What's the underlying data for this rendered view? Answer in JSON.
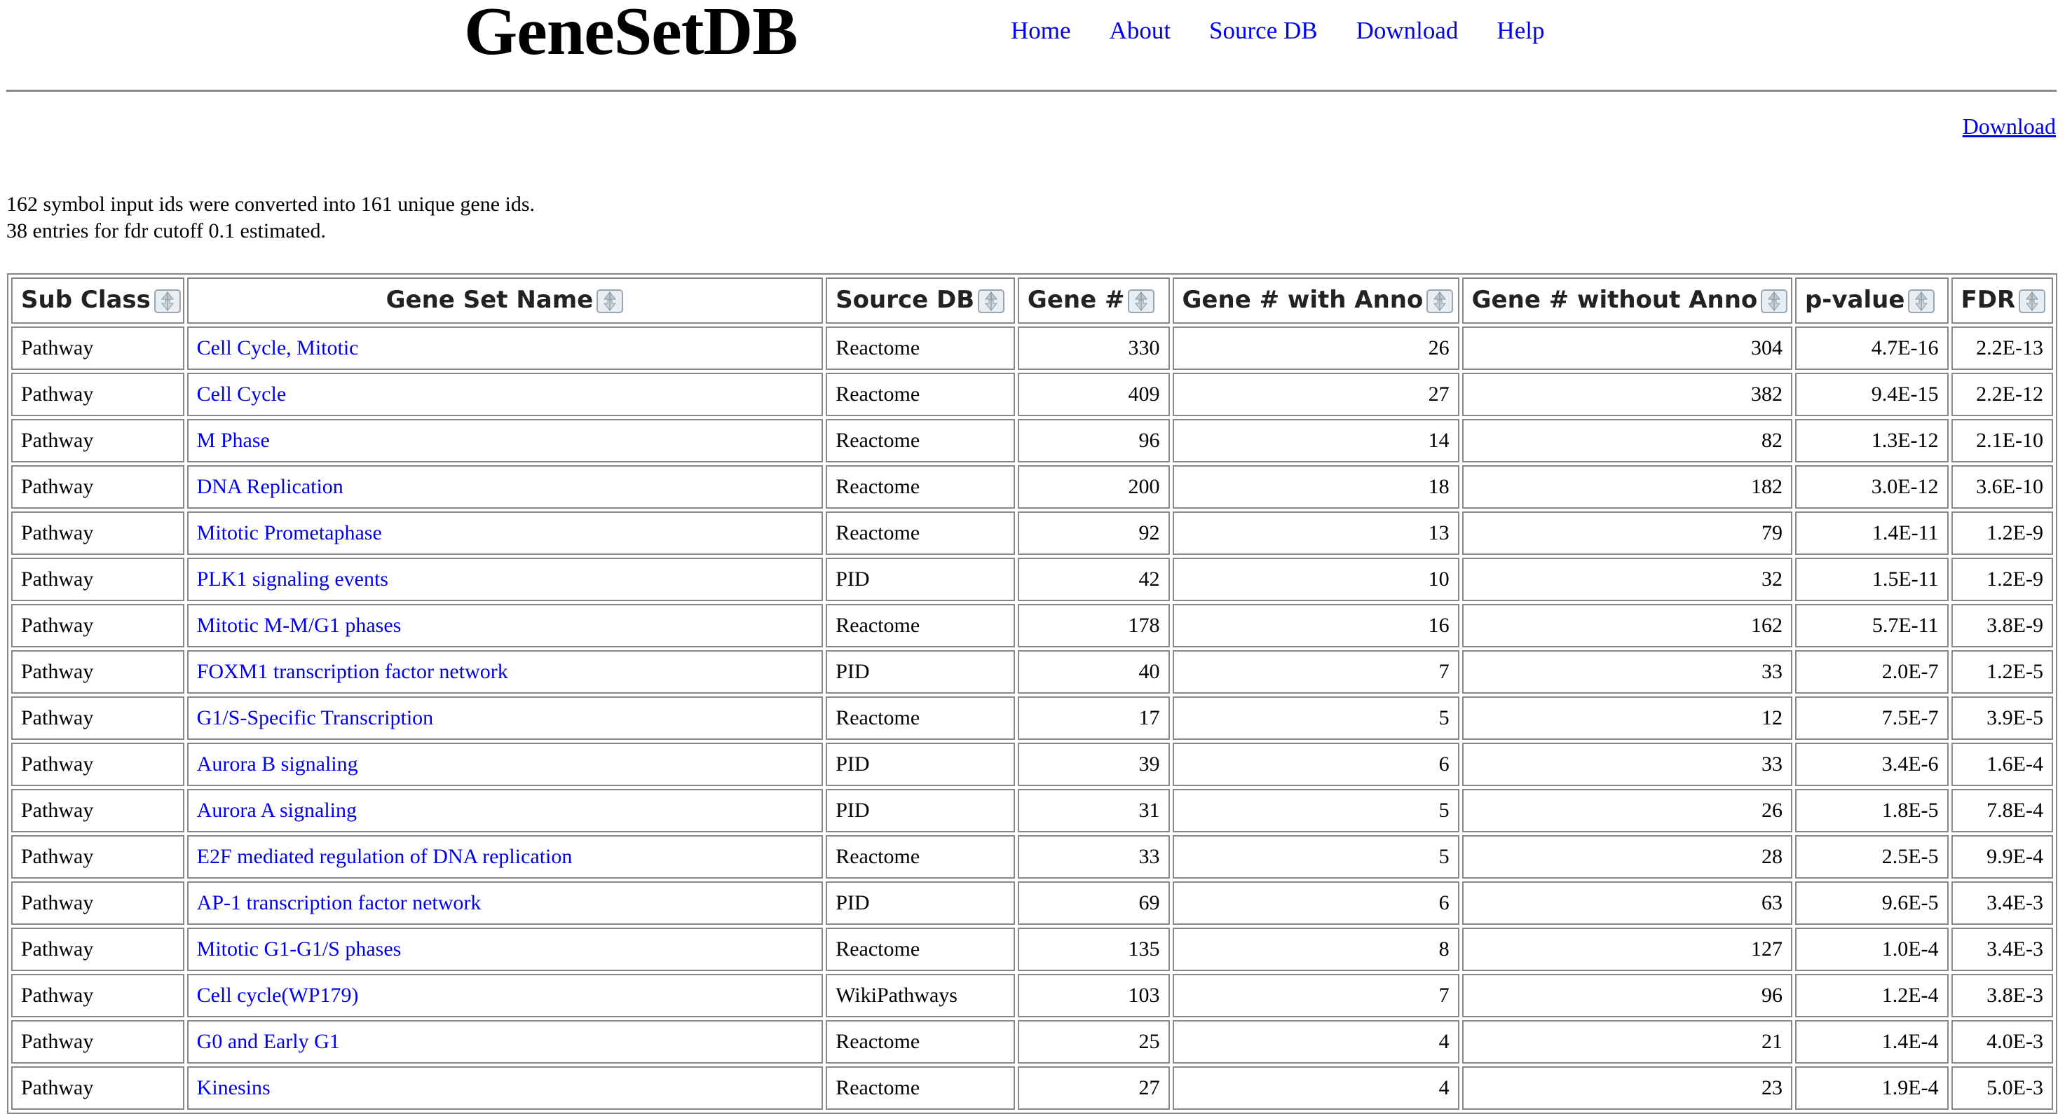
{
  "app": {
    "logo": "GeneSetDB"
  },
  "nav": [
    {
      "label": "Home"
    },
    {
      "label": "About"
    },
    {
      "label": "Source DB"
    },
    {
      "label": "Download"
    },
    {
      "label": "Help"
    }
  ],
  "download_link": "Download",
  "summary": {
    "line1": "162 symbol input ids were converted into 161 unique gene ids.",
    "line2": "38 entries for fdr cutoff 0.1 estimated."
  },
  "table": {
    "columns": [
      "Sub Class",
      "Gene Set Name",
      "Source DB",
      "Gene #",
      "Gene #  with Anno",
      "Gene #  without Anno",
      "p-value",
      "FDR"
    ],
    "sort_icon": "sort-arrows-icon",
    "rows": [
      [
        "Pathway",
        "Cell Cycle, Mitotic",
        "Reactome",
        "330",
        "26",
        "304",
        "4.7E-16",
        "2.2E-13"
      ],
      [
        "Pathway",
        "Cell Cycle",
        "Reactome",
        "409",
        "27",
        "382",
        "9.4E-15",
        "2.2E-12"
      ],
      [
        "Pathway",
        "M Phase",
        "Reactome",
        "96",
        "14",
        "82",
        "1.3E-12",
        "2.1E-10"
      ],
      [
        "Pathway",
        "DNA Replication",
        "Reactome",
        "200",
        "18",
        "182",
        "3.0E-12",
        "3.6E-10"
      ],
      [
        "Pathway",
        "Mitotic Prometaphase",
        "Reactome",
        "92",
        "13",
        "79",
        "1.4E-11",
        "1.2E-9"
      ],
      [
        "Pathway",
        "PLK1 signaling events",
        "PID",
        "42",
        "10",
        "32",
        "1.5E-11",
        "1.2E-9"
      ],
      [
        "Pathway",
        "Mitotic M-M/G1 phases",
        "Reactome",
        "178",
        "16",
        "162",
        "5.7E-11",
        "3.8E-9"
      ],
      [
        "Pathway",
        "FOXM1 transcription factor network",
        "PID",
        "40",
        "7",
        "33",
        "2.0E-7",
        "1.2E-5"
      ],
      [
        "Pathway",
        "G1/S-Specific Transcription",
        "Reactome",
        "17",
        "5",
        "12",
        "7.5E-7",
        "3.9E-5"
      ],
      [
        "Pathway",
        "Aurora B signaling",
        "PID",
        "39",
        "6",
        "33",
        "3.4E-6",
        "1.6E-4"
      ],
      [
        "Pathway",
        "Aurora A signaling",
        "PID",
        "31",
        "5",
        "26",
        "1.8E-5",
        "7.8E-4"
      ],
      [
        "Pathway",
        "E2F mediated regulation of DNA replication",
        "Reactome",
        "33",
        "5",
        "28",
        "2.5E-5",
        "9.9E-4"
      ],
      [
        "Pathway",
        "AP-1 transcription factor network",
        "PID",
        "69",
        "6",
        "63",
        "9.6E-5",
        "3.4E-3"
      ],
      [
        "Pathway",
        "Mitotic G1-G1/S phases",
        "Reactome",
        "135",
        "8",
        "127",
        "1.0E-4",
        "3.4E-3"
      ],
      [
        "Pathway",
        "Cell cycle(WP179)",
        "WikiPathways",
        "103",
        "7",
        "96",
        "1.2E-4",
        "3.8E-3"
      ],
      [
        "Pathway",
        "G0 and Early G1",
        "Reactome",
        "25",
        "4",
        "21",
        "1.4E-4",
        "4.0E-3"
      ],
      [
        "Pathway",
        "Kinesins",
        "Reactome",
        "27",
        "4",
        "23",
        "1.9E-4",
        "5.0E-3"
      ]
    ]
  },
  "colors": {
    "link": "#0000ee",
    "border": "#888888",
    "rule": "#8a8a8a"
  }
}
